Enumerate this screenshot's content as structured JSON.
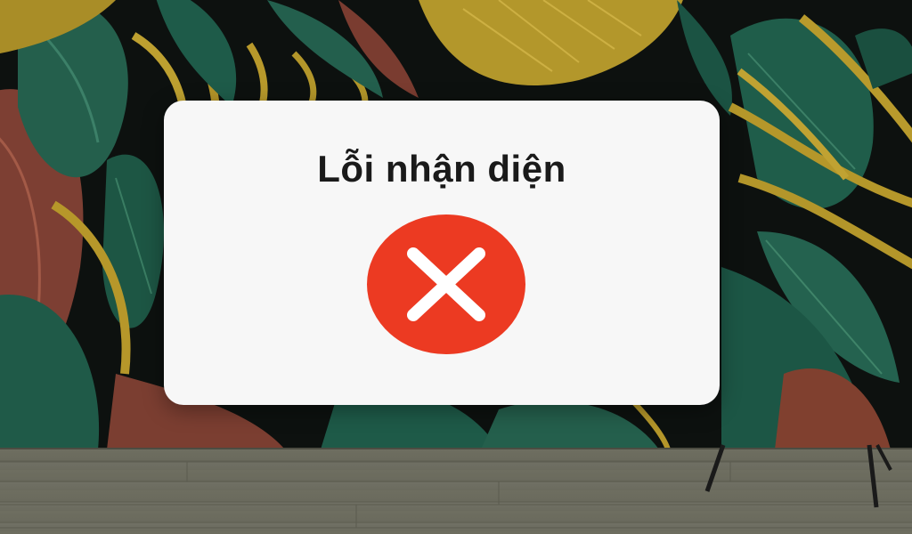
{
  "dialog": {
    "title": "Lỗi nhận diện",
    "status_icon": "error-x-circle-icon",
    "status_color": "#ec3a22"
  },
  "colors": {
    "dialog_background": "#f7f7f7",
    "title_text": "#1a1a1a",
    "leaf_green": "#1f5e4c",
    "leaf_gold": "#b59a2a",
    "leaf_rust": "#8a4a3a",
    "floor": "#6c6c5f"
  }
}
